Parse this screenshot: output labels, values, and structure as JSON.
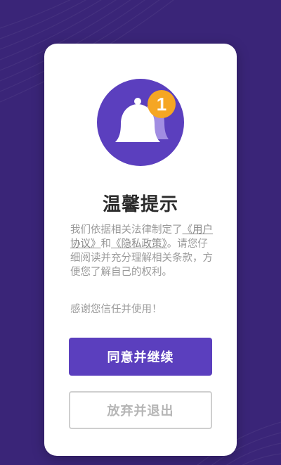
{
  "dialog": {
    "title": "温馨提示",
    "notification_count": "1",
    "body_prefix": "我们依据相关法律制定了",
    "user_agreement_link": "《用户协议》",
    "body_and": "和",
    "privacy_policy_link": "《隐私政策》",
    "body_suffix": "。请您仔细阅读并充分理解相关条款，方便您了解自己的权利。",
    "thanks": "感谢您信任并使用！",
    "agree_button": "同意并继续",
    "exit_button": "放弃并退出"
  },
  "colors": {
    "background": "#3a2578",
    "accent": "#5b3fbe",
    "badge": "#f5a623",
    "card": "#ffffff"
  }
}
